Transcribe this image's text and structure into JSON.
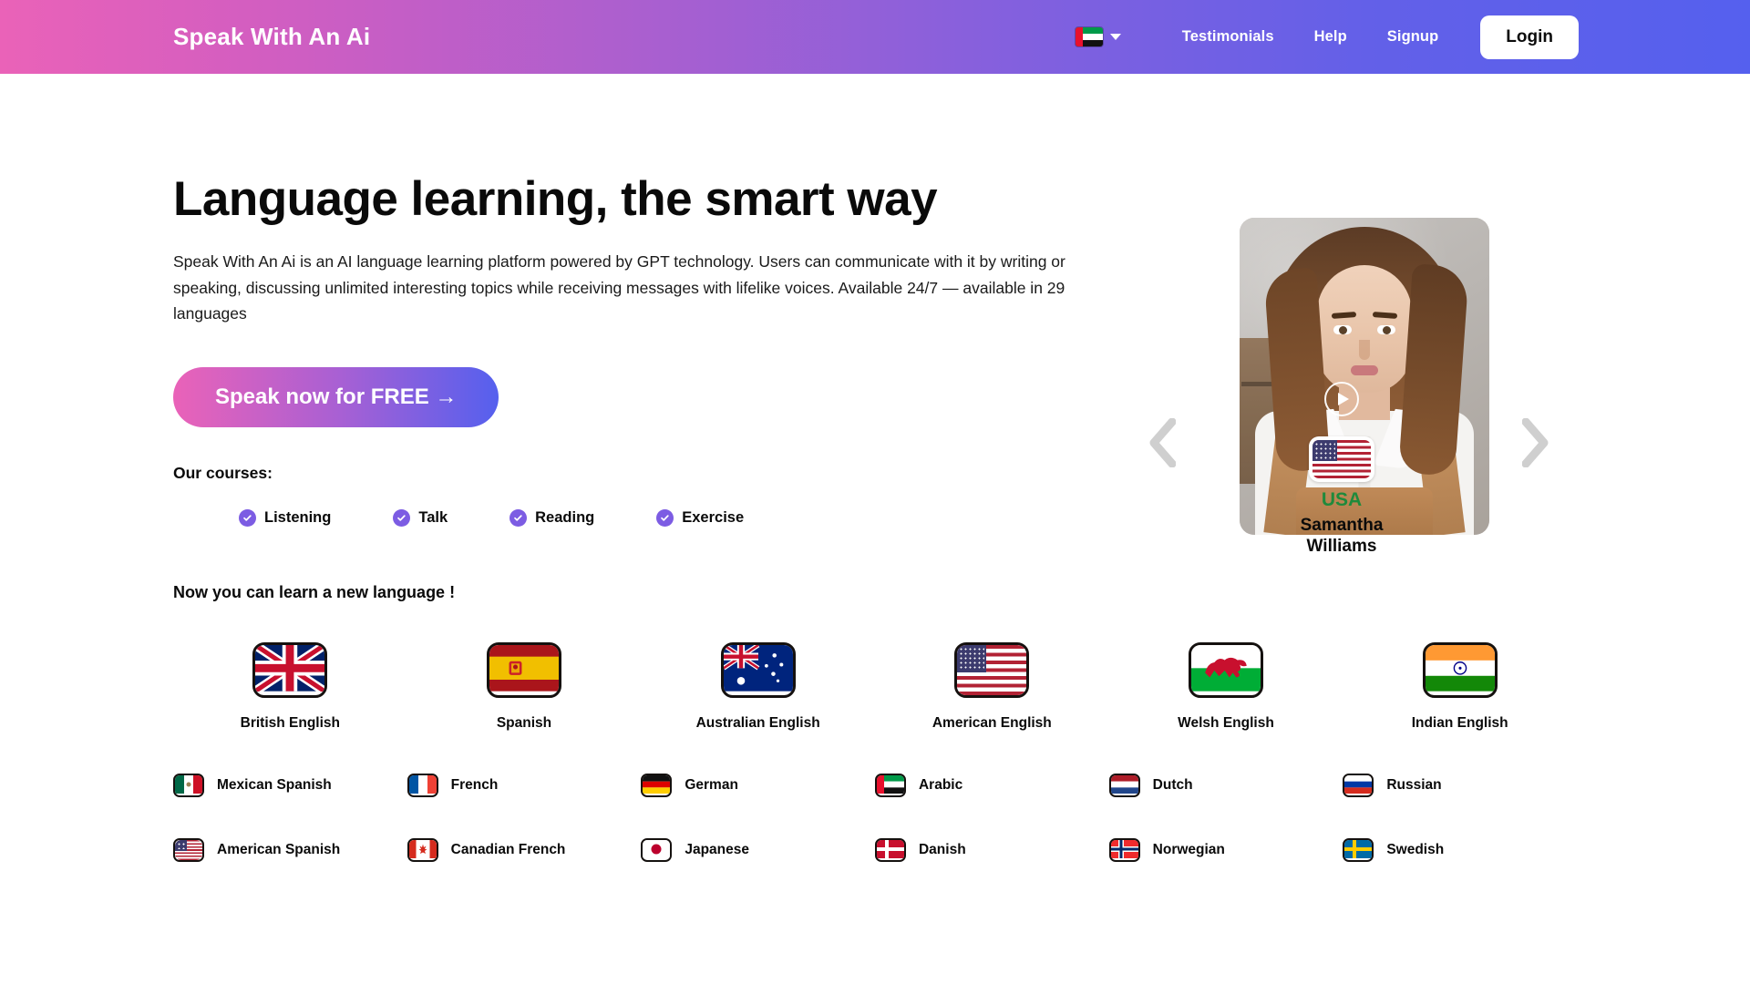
{
  "header": {
    "brand": "Speak With An Ai",
    "language_selector": {
      "flag": "flag-uae-icon",
      "caret": "chevron-down-icon"
    },
    "nav": [
      {
        "label": "Testimonials",
        "name": "nav-testimonials"
      },
      {
        "label": "Help",
        "name": "nav-help"
      },
      {
        "label": "Signup",
        "name": "nav-signup"
      }
    ],
    "login_label": "Login",
    "gradient_from": "#ea62b8",
    "gradient_to": "#5560ee"
  },
  "hero": {
    "headline": "Language learning, the smart way",
    "paragraph": "Speak With An Ai is an AI language learning platform powered by GPT technology. Users can communicate with it by writing or speaking, discussing unlimited interesting topics while receiving messages with lifelike voices. Available 24/7 — available in 29 languages",
    "cta_label": "Speak now for FREE →",
    "courses_label": "Our courses:",
    "courses": [
      {
        "label": "Listening"
      },
      {
        "label": "Talk"
      },
      {
        "label": "Reading"
      },
      {
        "label": "Exercise"
      }
    ],
    "accent_purple": "#7c5ce3"
  },
  "testimonial": {
    "country": "USA",
    "country_color": "#1f8a3c",
    "name_line1": "Samantha",
    "name_line2": "Williams",
    "flag": "flag-usa-icon",
    "play_button": "play-icon",
    "prev_arrow": "chevron-left-icon",
    "next_arrow": "chevron-right-icon"
  },
  "languages": {
    "title": "Now you can learn a new language !",
    "featured": [
      {
        "label": "British English",
        "flag": "flag-uk-icon"
      },
      {
        "label": "Spanish",
        "flag": "flag-spain-icon"
      },
      {
        "label": "Australian English",
        "flag": "flag-australia-icon"
      },
      {
        "label": "American English",
        "flag": "flag-usa-icon"
      },
      {
        "label": "Welsh English",
        "flag": "flag-wales-icon"
      },
      {
        "label": "Indian English",
        "flag": "flag-india-icon"
      }
    ],
    "more": [
      {
        "label": "Mexican Spanish",
        "flag": "flag-mexico-icon"
      },
      {
        "label": "French",
        "flag": "flag-france-icon"
      },
      {
        "label": "German",
        "flag": "flag-germany-icon"
      },
      {
        "label": "Arabic",
        "flag": "flag-uae-icon"
      },
      {
        "label": "Dutch",
        "flag": "flag-netherlands-icon"
      },
      {
        "label": "Russian",
        "flag": "flag-russia-icon"
      },
      {
        "label": "American Spanish",
        "flag": "flag-usa-icon"
      },
      {
        "label": "Canadian French",
        "flag": "flag-canada-icon"
      },
      {
        "label": "Japanese",
        "flag": "flag-japan-icon"
      },
      {
        "label": "Danish",
        "flag": "flag-denmark-icon"
      },
      {
        "label": "Norwegian",
        "flag": "flag-norway-icon"
      },
      {
        "label": "Swedish",
        "flag": "flag-sweden-icon"
      }
    ]
  }
}
